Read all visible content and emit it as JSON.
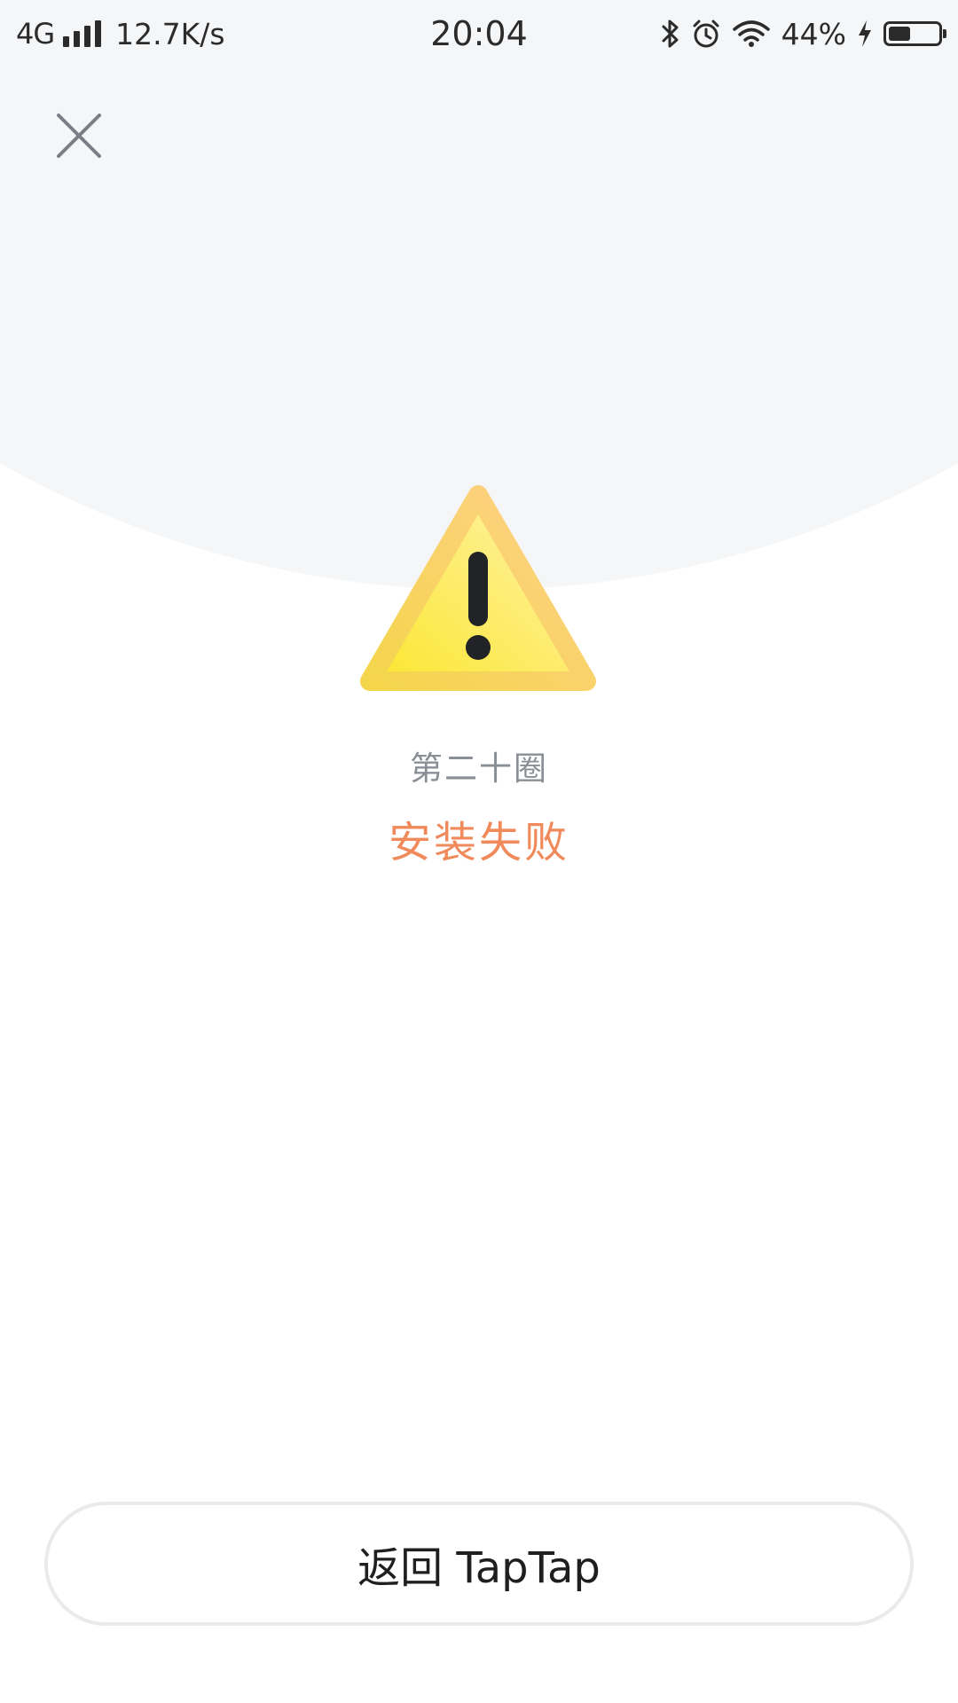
{
  "status_bar": {
    "network": "4G",
    "speed": "12.7K/s",
    "time": "20:04",
    "battery_percent_text": "44%",
    "battery_level": 0.44,
    "icons": [
      "signal-icon",
      "bluetooth-icon",
      "alarm-icon",
      "wifi-icon",
      "charging-icon",
      "battery-icon"
    ]
  },
  "header": {
    "close_icon": "close-icon"
  },
  "result": {
    "icon": "warning-icon",
    "app_name": "第二十圈",
    "status": "安装失败",
    "status_color": "#f08a5b"
  },
  "footer": {
    "return_label": "返回 TapTap"
  }
}
